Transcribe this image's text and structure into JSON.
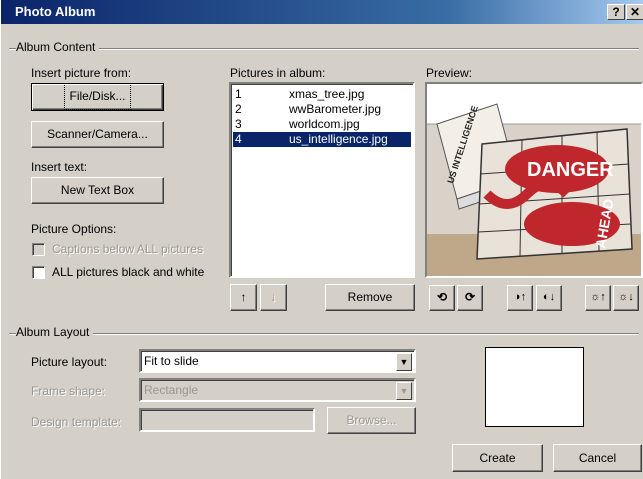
{
  "window": {
    "title": "Photo Album",
    "help_glyph": "?",
    "close_glyph": "✕"
  },
  "album_content": {
    "group_label": "Album Content",
    "insert_from_label": "Insert picture from:",
    "file_disk_button": "File/Disk...",
    "scanner_button": "Scanner/Camera...",
    "insert_text_label": "Insert text:",
    "new_text_box_button": "New Text Box",
    "picture_options_label": "Picture Options:",
    "captions_option": "Captions below ALL pictures",
    "black_white_option": "ALL pictures black and white",
    "pictures_label": "Pictures in album:",
    "pictures": [
      {
        "num": "1",
        "name": "xmas_tree.jpg",
        "selected": false
      },
      {
        "num": "2",
        "name": "wwBarometer.jpg",
        "selected": false
      },
      {
        "num": "3",
        "name": "worldcom.jpg",
        "selected": false
      },
      {
        "num": "4",
        "name": "us_intelligence.jpg",
        "selected": true
      }
    ],
    "move_up_glyph": "↑",
    "move_down_glyph": "↓",
    "remove_button": "Remove",
    "preview_label": "Preview:",
    "preview_texts": {
      "sign": "DANGER",
      "sign2": "AHEAD",
      "banner": "US INTELLIGENCE"
    }
  },
  "preview_tools": [
    {
      "name": "rotate-left-icon",
      "glyph": "⟲"
    },
    {
      "name": "rotate-right-icon",
      "glyph": "⟳"
    },
    {
      "name": "contrast-up-icon",
      "glyph": "◑↑"
    },
    {
      "name": "contrast-down-icon",
      "glyph": "◐↓"
    },
    {
      "name": "brightness-up-icon",
      "glyph": "☼↑"
    },
    {
      "name": "brightness-down-icon",
      "glyph": "☼↓"
    }
  ],
  "album_layout": {
    "group_label": "Album Layout",
    "picture_layout_label": "Picture layout:",
    "picture_layout_value": "Fit to slide",
    "frame_shape_label": "Frame shape:",
    "frame_shape_value": "Rectangle",
    "design_template_label": "Design template:",
    "design_template_value": "",
    "browse_button": "Browse..."
  },
  "footer": {
    "create_button": "Create",
    "cancel_button": "Cancel"
  }
}
